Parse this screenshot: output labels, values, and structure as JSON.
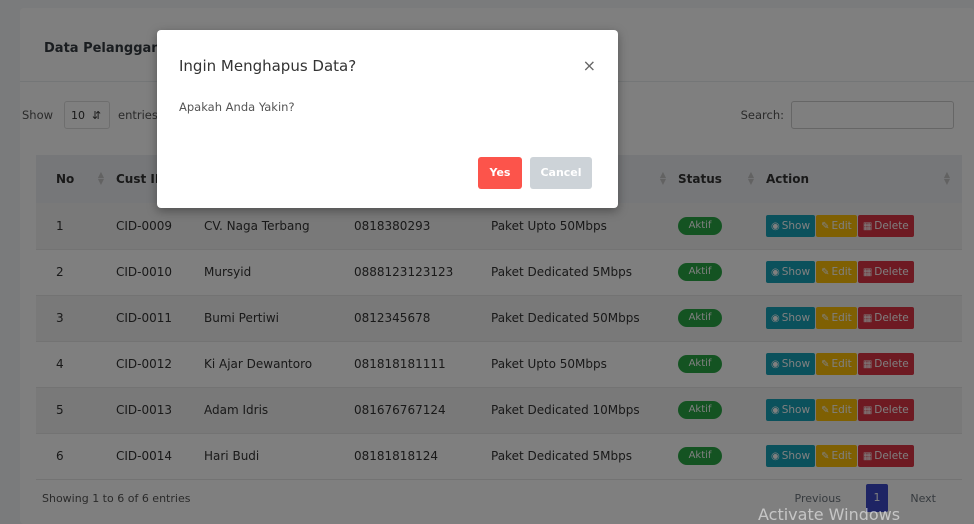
{
  "card": {
    "title": "Data Pelanggan"
  },
  "controls": {
    "show_label": "Show",
    "length_value": "10",
    "entries_label": "entries",
    "search_label": "Search:"
  },
  "table": {
    "headers": {
      "no": "No",
      "cust_id": "Cust ID",
      "status": "Status",
      "action": "Action"
    },
    "rows": [
      {
        "no": "1",
        "cust_id": "CID-0009",
        "nama": "CV. Naga Terbang",
        "telp": "0818380293",
        "paket": "Paket Upto 50Mbps",
        "status": "Aktif"
      },
      {
        "no": "2",
        "cust_id": "CID-0010",
        "nama": "Mursyid",
        "telp": "0888123123123",
        "paket": "Paket Dedicated 5Mbps",
        "status": "Aktif"
      },
      {
        "no": "3",
        "cust_id": "CID-0011",
        "nama": "Bumi Pertiwi",
        "telp": "0812345678",
        "paket": "Paket Dedicated 50Mbps",
        "status": "Aktif"
      },
      {
        "no": "4",
        "cust_id": "CID-0012",
        "nama": "Ki Ajar Dewantoro",
        "telp": "081818181111",
        "paket": "Paket Upto 50Mbps",
        "status": "Aktif"
      },
      {
        "no": "5",
        "cust_id": "CID-0013",
        "nama": "Adam Idris",
        "telp": "081676767124",
        "paket": "Paket Dedicated 10Mbps",
        "status": "Aktif"
      },
      {
        "no": "6",
        "cust_id": "CID-0014",
        "nama": "Hari Budi",
        "telp": "08181818124",
        "paket": "Paket Dedicated 5Mbps",
        "status": "Aktif"
      }
    ],
    "actions": {
      "show": "Show",
      "edit": "Edit",
      "delete": "Delete"
    }
  },
  "footer": {
    "info": "Showing 1 to 6 of 6 entries",
    "previous": "Previous",
    "page": "1",
    "next": "Next"
  },
  "watermark": "Activate Windows",
  "modal": {
    "title": "Ingin Menghapus Data?",
    "close": "×",
    "body": "Apakah Anda Yakin?",
    "yes": "Yes",
    "cancel": "Cancel"
  },
  "colors": {
    "badge_active": "#28a745",
    "show": "#17a2b8",
    "edit": "#ffc107",
    "delete": "#dc3545",
    "yes": "#fc544b",
    "cancel": "#cdd3d8",
    "page_active": "#3c48c9"
  },
  "icons": {
    "show": "eye-icon",
    "edit": "pencil-icon",
    "delete": "trash-icon",
    "close": "close-icon",
    "sort": "sort-icon"
  }
}
